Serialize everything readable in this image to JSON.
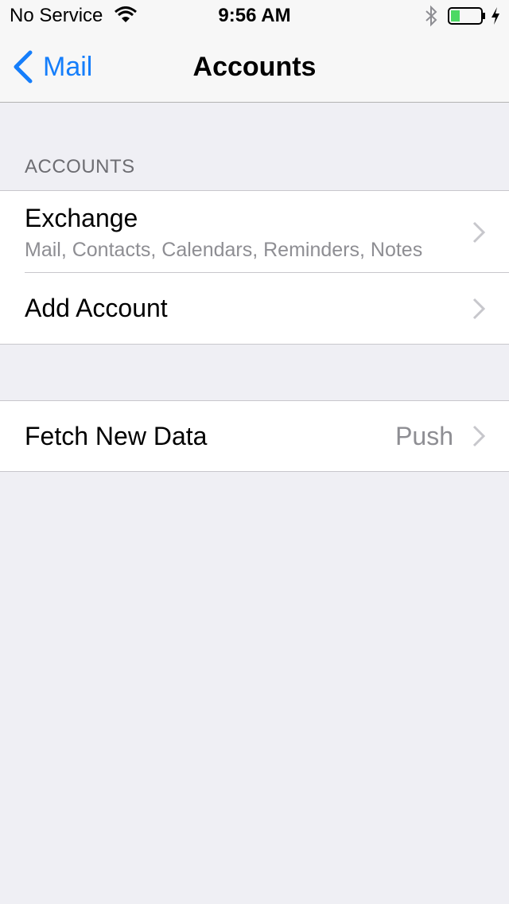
{
  "status_bar": {
    "carrier": "No Service",
    "time": "9:56 AM",
    "battery_level": 0.3,
    "battery_color": "#4cd964"
  },
  "nav": {
    "back_label": "Mail",
    "title": "Accounts",
    "accent_color": "#157efb"
  },
  "accounts_section": {
    "header": "ACCOUNTS",
    "items": [
      {
        "title": "Exchange",
        "subtitle": "Mail, Contacts, Calendars, Reminders, Notes"
      },
      {
        "title": "Add Account"
      }
    ]
  },
  "fetch": {
    "label": "Fetch New Data",
    "value": "Push"
  },
  "icons": [
    "wifi-icon",
    "bluetooth-icon",
    "battery-icon",
    "charging-bolt-icon",
    "back-chevron-icon",
    "chevron-right-icon"
  ]
}
